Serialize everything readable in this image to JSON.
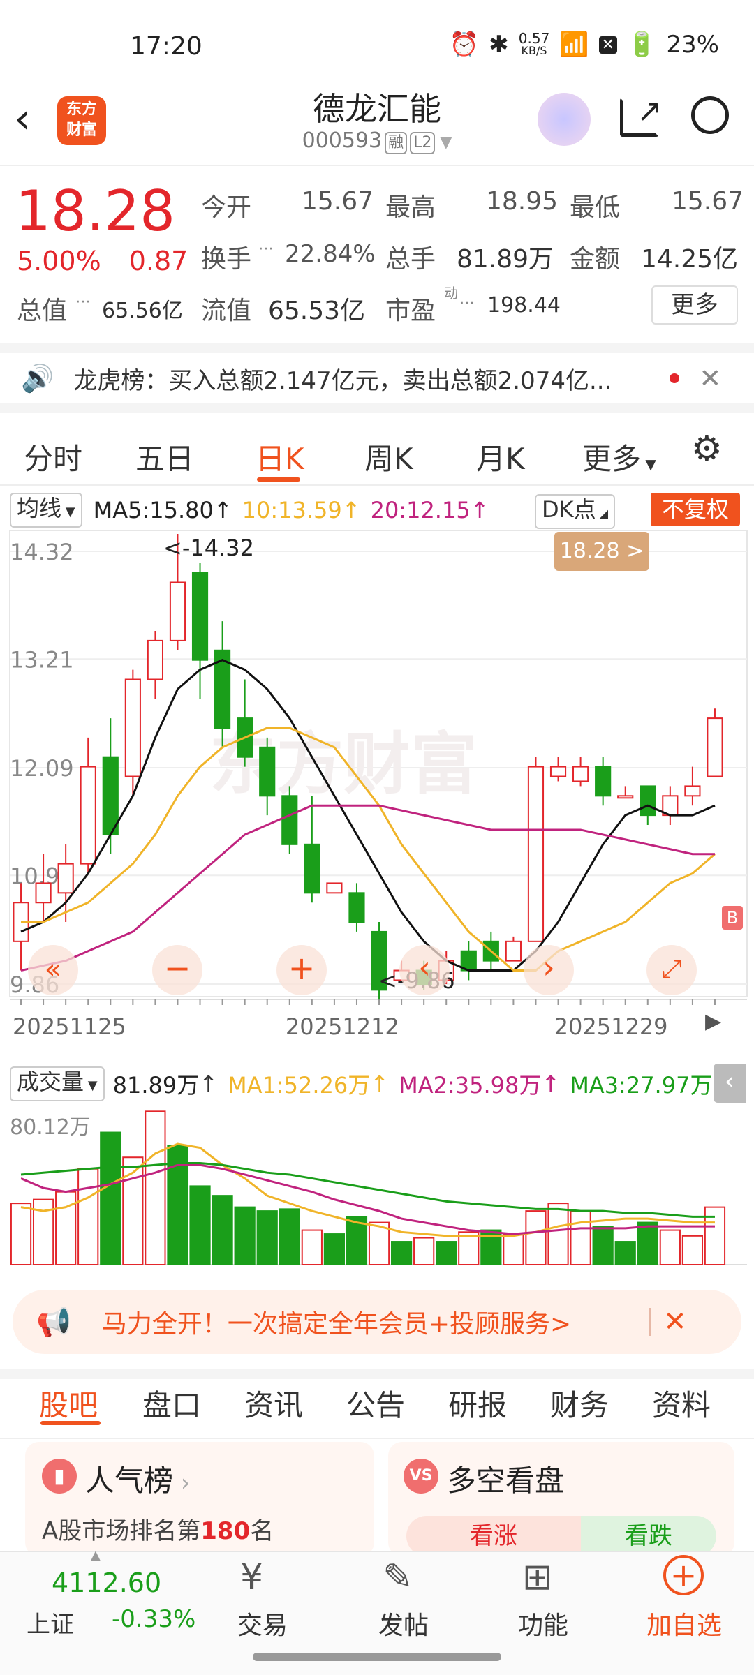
{
  "status": {
    "time": "17:20",
    "net_speed_value": "0.57",
    "net_speed_unit": "KB/S",
    "battery": "23%"
  },
  "header": {
    "logo_text_line1": "东方",
    "logo_text_line2": "财富",
    "stock_name": "德龙汇能",
    "stock_code": "000593",
    "badge_margin": "融",
    "badge_level": "L2"
  },
  "quote": {
    "price": "18.28",
    "change_pct": "5.00%",
    "change_amt": "0.87",
    "open_label": "今开",
    "open": "15.67",
    "high_label": "最高",
    "high": "18.95",
    "low_label": "最低",
    "low": "15.67",
    "turnover_label": "换手",
    "turnover": "22.84%",
    "volume_label": "总手",
    "volume": "81.89万",
    "amount_label": "金额",
    "amount": "14.25亿",
    "mktcap_label": "总值",
    "mktcap": "65.56亿",
    "float_label": "流值",
    "float_cap": "65.53亿",
    "pe_label": "市盈",
    "pe_sup": "动",
    "pe": "198.44",
    "more": "更多"
  },
  "notice": {
    "text": "龙虎榜：买入总额2.147亿元，卖出总额2.074亿..."
  },
  "chart_tabs": {
    "items": [
      "分时",
      "五日",
      "日K",
      "周K",
      "月K",
      "更多"
    ],
    "active": "日K"
  },
  "kline": {
    "ma_select": "均线",
    "ma5": "MA5:15.80",
    "ma10": "10:13.59",
    "ma20": "20:12.15",
    "dk": "DK点",
    "adjust": "不复权",
    "y_ticks": [
      "14.32",
      "13.21",
      "12.09",
      "10.98",
      "9.86"
    ],
    "high_note": "<-14.32",
    "low_note": "<-9.86",
    "price_tag": "18.28 >",
    "x_dates": [
      "20251125",
      "20251212",
      "20251229"
    ],
    "buy_mark": "B",
    "watermark": "东方财富"
  },
  "volume": {
    "select": "成交量",
    "value": "81.89万",
    "ma1": "MA1:52.26万",
    "ma2": "MA2:35.98万",
    "ma3": "MA3:27.97万",
    "y_max": "80.12万"
  },
  "chart_data": [
    {
      "type": "candlestick",
      "title": "",
      "ylim": [
        9.86,
        14.32
      ],
      "x": [
        "20251125",
        "20251212",
        "20251229"
      ],
      "candles": [
        [
          10.3,
          10.7,
          10.0,
          10.9,
          "red"
        ],
        [
          10.7,
          10.9,
          10.5,
          11.2,
          "red"
        ],
        [
          10.8,
          11.1,
          10.5,
          11.3,
          "red"
        ],
        [
          11.1,
          12.1,
          11.0,
          12.4,
          "red"
        ],
        [
          12.2,
          11.4,
          11.2,
          12.6,
          "green"
        ],
        [
          12.0,
          13.0,
          11.8,
          13.1,
          "red"
        ],
        [
          13.0,
          13.4,
          12.8,
          13.5,
          "red"
        ],
        [
          13.4,
          14.0,
          13.3,
          14.5,
          "red"
        ],
        [
          14.1,
          13.2,
          12.8,
          14.2,
          "green"
        ],
        [
          13.3,
          12.5,
          12.3,
          13.6,
          "green"
        ],
        [
          12.6,
          12.2,
          12.1,
          13.0,
          "green"
        ],
        [
          12.3,
          11.8,
          11.6,
          12.4,
          "green"
        ],
        [
          11.8,
          11.3,
          11.2,
          11.9,
          "green"
        ],
        [
          11.3,
          10.8,
          10.7,
          11.8,
          "green"
        ],
        [
          10.8,
          10.9,
          10.8,
          10.9,
          "red"
        ],
        [
          10.8,
          10.5,
          10.4,
          10.9,
          "green"
        ],
        [
          10.4,
          9.8,
          9.7,
          10.5,
          "green"
        ],
        [
          9.9,
          10.0,
          9.9,
          10.1,
          "red"
        ],
        [
          10.0,
          9.86,
          9.8,
          10.1,
          "green"
        ],
        [
          9.9,
          10.1,
          9.86,
          10.2,
          "red"
        ],
        [
          10.2,
          10.0,
          9.9,
          10.3,
          "green"
        ],
        [
          10.3,
          10.1,
          10.0,
          10.4,
          "green"
        ],
        [
          10.1,
          10.3,
          10.1,
          10.35,
          "red"
        ],
        [
          10.3,
          12.1,
          10.3,
          12.2,
          "red"
        ],
        [
          12.0,
          12.1,
          11.95,
          12.2,
          "red"
        ],
        [
          11.95,
          12.1,
          11.9,
          12.2,
          "red"
        ],
        [
          12.1,
          11.8,
          11.7,
          12.2,
          "green"
        ],
        [
          11.8,
          11.8,
          11.8,
          11.9,
          "red"
        ],
        [
          11.9,
          11.6,
          11.5,
          11.9,
          "green"
        ],
        [
          11.6,
          11.8,
          11.5,
          11.9,
          "red"
        ],
        [
          11.8,
          11.9,
          11.7,
          12.1,
          "red"
        ],
        [
          12.0,
          12.6,
          12.0,
          12.7,
          "red"
        ]
      ],
      "series": [
        {
          "name": "MA5",
          "values": [
            10.4,
            10.5,
            10.7,
            11.0,
            11.4,
            11.8,
            12.4,
            12.9,
            13.1,
            13.2,
            13.1,
            12.9,
            12.6,
            12.2,
            11.8,
            11.4,
            11.0,
            10.6,
            10.3,
            10.1,
            10.0,
            10.0,
            10.0,
            10.2,
            10.5,
            10.9,
            11.3,
            11.6,
            11.7,
            11.6,
            11.6,
            11.7
          ]
        },
        {
          "name": "MA10",
          "values": [
            10.5,
            10.5,
            10.6,
            10.7,
            10.9,
            11.1,
            11.4,
            11.8,
            12.1,
            12.3,
            12.4,
            12.5,
            12.5,
            12.4,
            12.3,
            12.0,
            11.7,
            11.3,
            11.0,
            10.7,
            10.4,
            10.2,
            10.0,
            10.0,
            10.2,
            10.3,
            10.4,
            10.5,
            10.7,
            10.9,
            11.0,
            11.2
          ]
        },
        {
          "name": "MA20",
          "values": [
            10.0,
            10.05,
            10.1,
            10.2,
            10.3,
            10.4,
            10.6,
            10.8,
            11.0,
            11.2,
            11.4,
            11.5,
            11.6,
            11.7,
            11.7,
            11.7,
            11.7,
            11.65,
            11.6,
            11.55,
            11.5,
            11.45,
            11.45,
            11.45,
            11.45,
            11.45,
            11.4,
            11.35,
            11.3,
            11.25,
            11.2,
            11.2
          ]
        }
      ]
    },
    {
      "type": "bar",
      "title": "",
      "ylim": [
        0,
        80.12
      ],
      "values": [
        [
          32,
          "red"
        ],
        [
          34,
          "red"
        ],
        [
          38,
          "red"
        ],
        [
          50,
          "red"
        ],
        [
          69,
          "green"
        ],
        [
          56,
          "red"
        ],
        [
          80,
          "red"
        ],
        [
          62,
          "green"
        ],
        [
          41,
          "green"
        ],
        [
          36,
          "green"
        ],
        [
          30,
          "green"
        ],
        [
          28,
          "green"
        ],
        [
          29,
          "green"
        ],
        [
          18,
          "red"
        ],
        [
          16,
          "green"
        ],
        [
          25,
          "green"
        ],
        [
          22,
          "red"
        ],
        [
          12,
          "green"
        ],
        [
          14,
          "red"
        ],
        [
          12,
          "green"
        ],
        [
          17,
          "red"
        ],
        [
          18,
          "green"
        ],
        [
          16,
          "red"
        ],
        [
          28,
          "red"
        ],
        [
          32,
          "red"
        ],
        [
          28,
          "red"
        ],
        [
          20,
          "green"
        ],
        [
          12,
          "green"
        ],
        [
          22,
          "green"
        ],
        [
          18,
          "red"
        ],
        [
          15,
          "red"
        ],
        [
          30,
          "red"
        ]
      ],
      "series": [
        {
          "name": "MA1",
          "values": [
            30,
            28,
            30,
            35,
            42,
            48,
            58,
            63,
            61,
            52,
            45,
            36,
            32,
            28,
            25,
            22,
            20,
            17,
            16,
            15,
            15,
            15,
            15,
            17,
            20,
            22,
            23,
            24,
            24,
            23,
            22,
            22
          ]
        },
        {
          "name": "MA2",
          "values": [
            45,
            40,
            38,
            40,
            42,
            45,
            48,
            52,
            52,
            50,
            47,
            44,
            41,
            38,
            34,
            31,
            28,
            24,
            22,
            20,
            18,
            17,
            16,
            17,
            18,
            19,
            19,
            19,
            20,
            20,
            20,
            20
          ]
        },
        {
          "name": "MA3",
          "values": [
            47,
            48,
            49,
            50,
            51,
            51,
            52,
            53,
            53,
            52,
            50,
            48,
            47,
            45,
            43,
            41,
            39,
            37,
            35,
            33,
            32,
            31,
            30,
            29,
            29,
            28,
            28,
            27,
            27,
            26,
            25,
            25
          ]
        }
      ]
    }
  ],
  "ad": {
    "text": "马力全开！一次搞定全年会员+投顾服务>"
  },
  "info_tabs": {
    "items": [
      "股吧",
      "盘口",
      "资讯",
      "公告",
      "研报",
      "财务",
      "资料"
    ],
    "active": "股吧"
  },
  "cards": {
    "popular_title": "人气榜",
    "popular_text_prefix": "A股市场排名第",
    "popular_rank": "180",
    "popular_text_suffix": "名",
    "longshort_title": "多空看盘",
    "bull": "看涨",
    "bear": "看跌"
  },
  "bottom": {
    "index_value": "4112.60",
    "index_name": "上证",
    "index_chg": "-0.33%",
    "nav": [
      "交易",
      "发帖",
      "功能",
      "加自选"
    ]
  },
  "colors": {
    "red": "#e3262b",
    "green": "#1a9e1a",
    "accent": "#f0521e",
    "ma5": "#111111",
    "ma10": "#f0b429",
    "ma20": "#c0237e"
  }
}
